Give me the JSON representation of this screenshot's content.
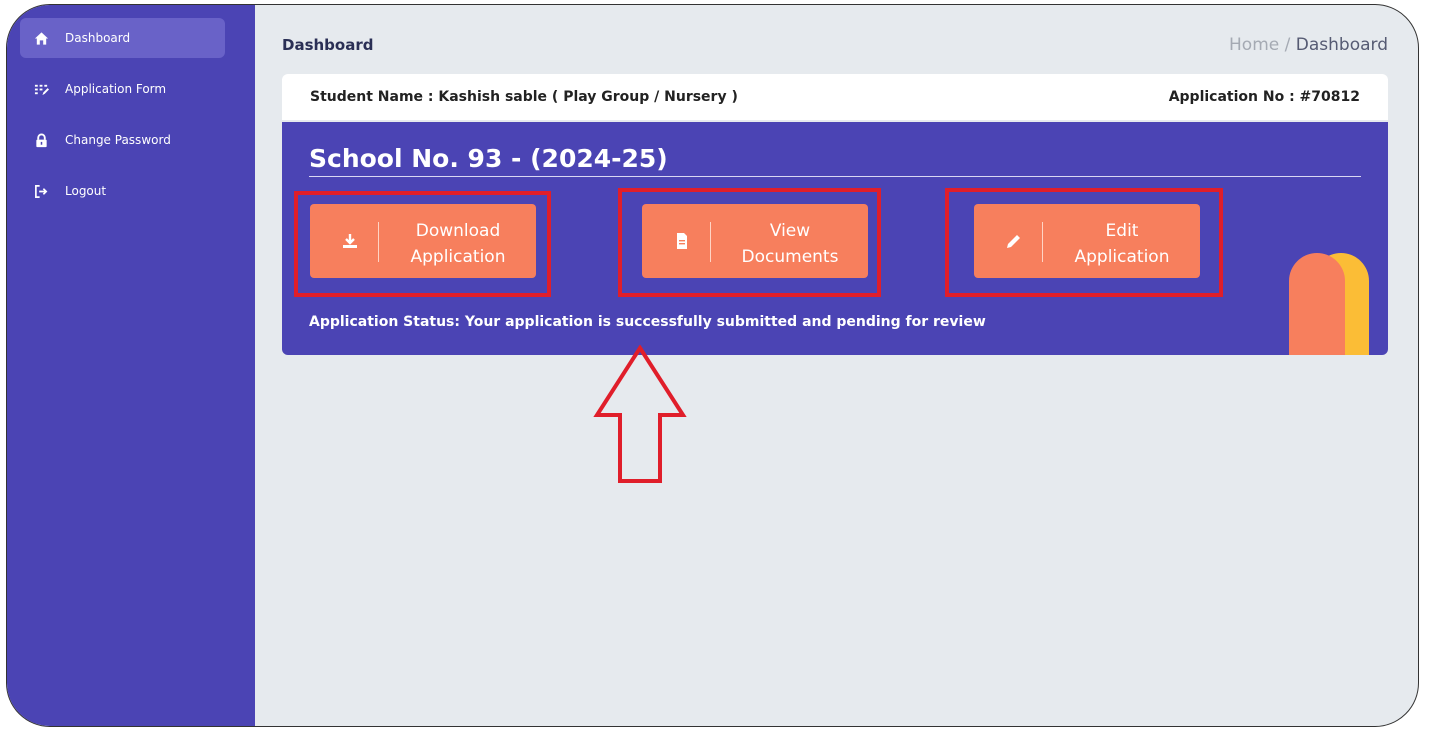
{
  "sidebar": {
    "items": [
      {
        "label": "Dashboard",
        "icon": "home-icon",
        "active": true
      },
      {
        "label": "Application Form",
        "icon": "form-icon",
        "active": false
      },
      {
        "label": "Change Password",
        "icon": "lock-icon",
        "active": false
      },
      {
        "label": "Logout",
        "icon": "logout-icon",
        "active": false
      }
    ]
  },
  "header": {
    "title": "Dashboard",
    "breadcrumb": {
      "home": "Home",
      "separator": "/",
      "current": "Dashboard"
    }
  },
  "student": {
    "name_text": "Student Name : Kashish sable ( Play Group / Nursery )",
    "application_no_text": "Application No : #70812"
  },
  "card": {
    "school_title": "School No. 93 - (2024-25)",
    "buttons": [
      {
        "line1": "Download",
        "line2": "Application",
        "icon": "download-icon"
      },
      {
        "line1": "View",
        "line2": "Documents",
        "icon": "document-icon"
      },
      {
        "line1": "Edit",
        "line2": "Application",
        "icon": "pencil-icon"
      }
    ],
    "status_text": "Application Status: Your application is successfully submitted and pending for review"
  },
  "colors": {
    "sidebar": "#4b44b4",
    "card": "#4b44b4",
    "button": "#f77f5d",
    "highlight": "#e01e2a",
    "accent_yellow": "#fbbd36"
  }
}
